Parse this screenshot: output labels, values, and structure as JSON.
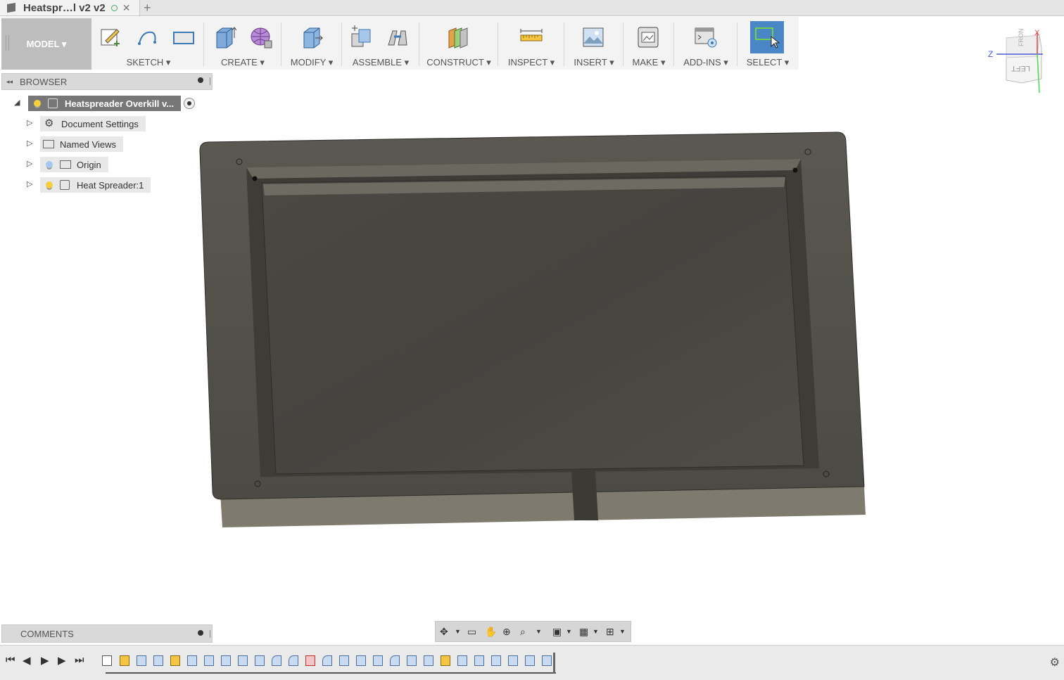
{
  "tab": {
    "title": "Heatspr…l v2 v2",
    "close": "✕",
    "new": "+"
  },
  "toolbar": {
    "workspace": "MODEL ▾",
    "groups": [
      {
        "label": "SKETCH ▾"
      },
      {
        "label": "CREATE ▾"
      },
      {
        "label": "MODIFY ▾"
      },
      {
        "label": "ASSEMBLE ▾"
      },
      {
        "label": "CONSTRUCT ▾"
      },
      {
        "label": "INSPECT ▾"
      },
      {
        "label": "INSERT ▾"
      },
      {
        "label": "MAKE ▾"
      },
      {
        "label": "ADD-INS ▾"
      },
      {
        "label": "SELECT ▾"
      }
    ]
  },
  "browser": {
    "title": "BROWSER",
    "root": "Heatspreader Overkill v...",
    "items": [
      {
        "label": "Document Settings"
      },
      {
        "label": "Named Views"
      },
      {
        "label": "Origin"
      },
      {
        "label": "Heat Spreader:1"
      }
    ]
  },
  "comments": {
    "title": "COMMENTS"
  },
  "viewcube": {
    "face": "LEFT",
    "top_face": "FRONT",
    "axis_z": "Z",
    "axis_x": "X"
  },
  "colors": {
    "accent": "#3d78b8",
    "model_body": "#5d5a52",
    "select_active": "#4a86c5"
  }
}
